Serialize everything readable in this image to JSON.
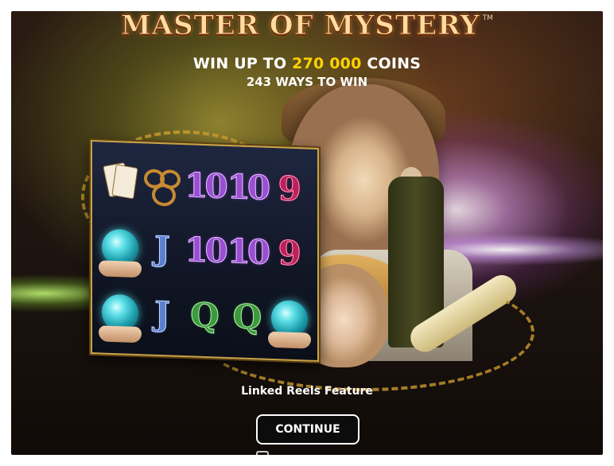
{
  "game": {
    "logo_text": "MASTER OF MYSTERY",
    "trademark": "TM",
    "win_prefix": "WIN UP TO",
    "win_amount": "270 000",
    "win_suffix": "COINS",
    "ways": "243 WAYS TO WIN",
    "feature_label": "Linked Reels Feature",
    "continue_label": "CONTINUE"
  },
  "reels": [
    [
      "cards-dagger-icon",
      "mask-icon",
      "10",
      "10",
      "9"
    ],
    [
      "crystal-ball-icon",
      "J",
      "10",
      "10",
      "9"
    ],
    [
      "crystal-ball-icon",
      "J",
      "Q",
      "Q",
      "crystal-ball-icon"
    ]
  ],
  "colors": {
    "gold_amount": "#ffd200",
    "reel_frame": "#c9a24a",
    "button_border": "#ffffff"
  }
}
